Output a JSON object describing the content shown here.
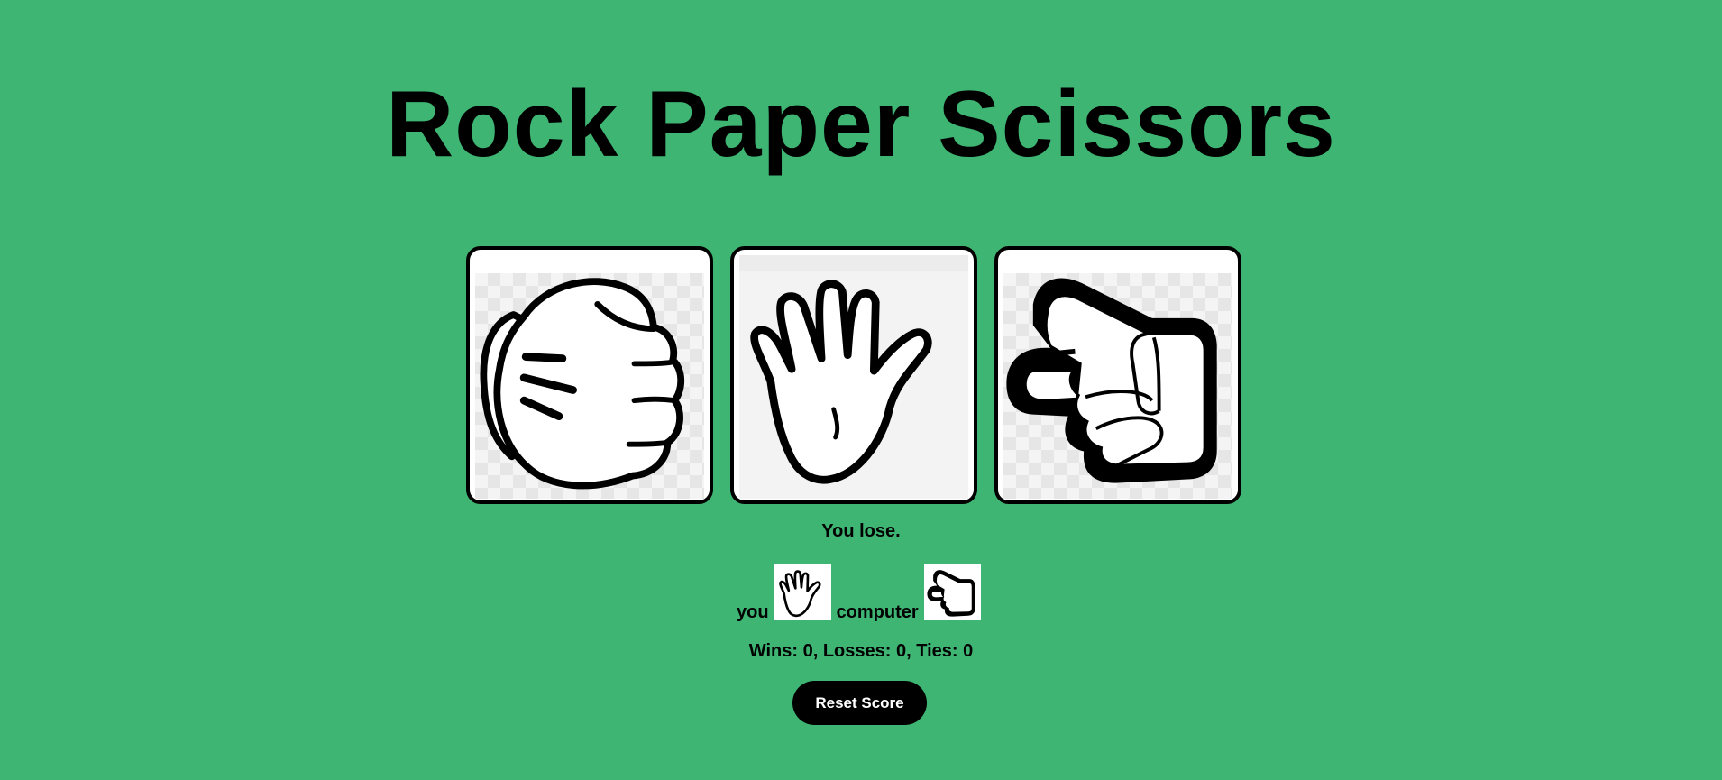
{
  "title": "Rock Paper Scissors",
  "choices": [
    {
      "name": "rock",
      "icon": "rock-hand-icon"
    },
    {
      "name": "paper",
      "icon": "paper-hand-icon"
    },
    {
      "name": "scissors",
      "icon": "scissors-hand-icon"
    }
  ],
  "result": {
    "message": "You lose.",
    "you_label": "you",
    "computer_label": "computer",
    "you_move_icon": "paper-hand-icon",
    "computer_move_icon": "scissors-hand-icon"
  },
  "score": {
    "text": "Wins: 0, Losses: 0, Ties: 0"
  },
  "reset_button": {
    "label": "Reset Score"
  },
  "colors": {
    "background": "#3eb573",
    "button_background": "#000000",
    "button_text": "#ffffff"
  }
}
